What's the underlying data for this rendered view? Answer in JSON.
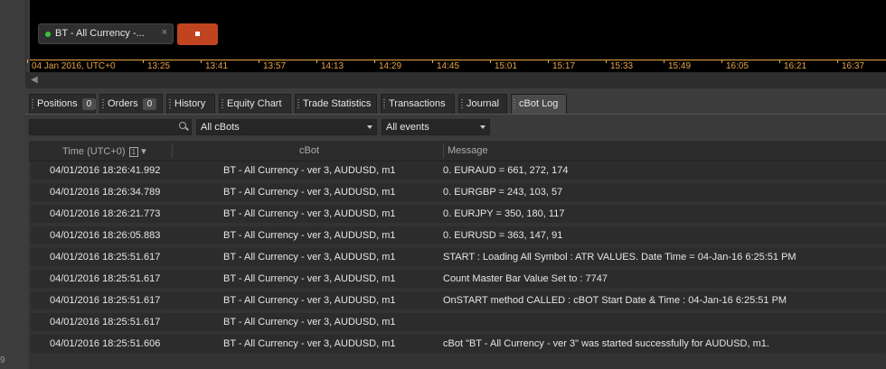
{
  "gutter": {
    "digit": "9"
  },
  "chart": {
    "bot_chip": {
      "label": "BT - All Currency -...",
      "close": "×",
      "status_color": "#39c437"
    },
    "stop_button_color": "#c0441f",
    "time_axis": {
      "first_label": "04 Jan 2016, UTC+0",
      "ticks": [
        "13:25",
        "13:41",
        "13:57",
        "14:13",
        "14:29",
        "14:45",
        "15:01",
        "15:17",
        "15:33",
        "15:49",
        "16:05",
        "16:21",
        "16:37"
      ],
      "color": "#e8a447"
    }
  },
  "tabs": [
    {
      "label": "Positions",
      "badge": "0"
    },
    {
      "label": "Orders",
      "badge": "0"
    },
    {
      "label": "History"
    },
    {
      "label": "Equity Chart"
    },
    {
      "label": "Trade Statistics"
    },
    {
      "label": "Transactions"
    },
    {
      "label": "Journal"
    },
    {
      "label": "cBot Log",
      "active": true
    }
  ],
  "filters": {
    "search_placeholder": "",
    "cbots_selected": "All cBots",
    "events_selected": "All events"
  },
  "grid": {
    "columns": {
      "time": "Time (UTC+0)",
      "sort_indicator": "1",
      "cbot": "cBot",
      "message": "Message"
    },
    "rows": [
      {
        "time": "04/01/2016 18:26:41.992",
        "cbot": "BT - All Currency - ver 3, AUDUSD, m1",
        "message": "0. EURAUD =  661,  272,  174"
      },
      {
        "time": "04/01/2016 18:26:34.789",
        "cbot": "BT - All Currency - ver 3, AUDUSD, m1",
        "message": "0. EURGBP =  243,  103,  57"
      },
      {
        "time": "04/01/2016 18:26:21.773",
        "cbot": "BT - All Currency - ver 3, AUDUSD, m1",
        "message": "0. EURJPY =  350,  180,  117"
      },
      {
        "time": "04/01/2016 18:26:05.883",
        "cbot": "BT - All Currency - ver 3, AUDUSD, m1",
        "message": "0. EURUSD =  363,  147,  91"
      },
      {
        "time": "04/01/2016 18:25:51.617",
        "cbot": "BT - All Currency - ver 3, AUDUSD, m1",
        "message": "START  :   Loading All Symbol : ATR VALUES.        Date Time =  04-Jan-16 6:25:51 PM"
      },
      {
        "time": "04/01/2016 18:25:51.617",
        "cbot": "BT - All Currency - ver 3, AUDUSD, m1",
        "message": "Count Master Bar Value Set to : 7747"
      },
      {
        "time": "04/01/2016 18:25:51.617",
        "cbot": "BT - All Currency - ver 3, AUDUSD, m1",
        "message": "OnSTART method CALLED :  cBOT Start Date & Time : 04-Jan-16 6:25:51 PM"
      },
      {
        "time": "04/01/2016 18:25:51.617",
        "cbot": "BT - All Currency - ver 3, AUDUSD, m1",
        "message": ""
      },
      {
        "time": "04/01/2016 18:25:51.606",
        "cbot": "BT - All Currency - ver 3, AUDUSD, m1",
        "message": "cBot \"BT - All Currency - ver 3\" was started successfully for AUDUSD, m1."
      }
    ]
  }
}
